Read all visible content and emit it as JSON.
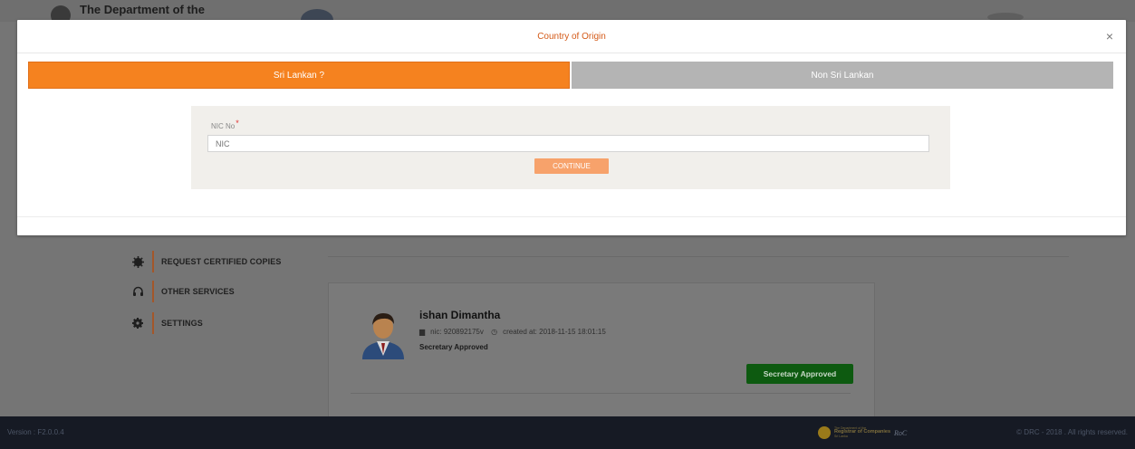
{
  "background": {
    "header": {
      "department_text": "The Department of the"
    },
    "sidebar": {
      "items": [
        {
          "label": "REQUEST CERTIFIED COPIES",
          "icon": "gear-badge-icon"
        },
        {
          "label": "OTHER SERVICES",
          "icon": "headset-icon"
        },
        {
          "label": "SETTINGS",
          "icon": "gear-icon"
        }
      ]
    },
    "card": {
      "name": "ishan Dimantha",
      "nic": "nic: 920892175v",
      "created_at": "created at: 2018-11-15 18:01:15",
      "status_text": "Secretary Approved",
      "status_button": "Secretary Approved"
    },
    "footer": {
      "version": "Version : F2.0.0.4",
      "copyright": "© DRC - 2018 . All rights reserved.",
      "logo_small": "The Department of the",
      "logo_big": "Registrar of Companies",
      "logo_sub": "Sri Lanka",
      "logo_roc": "RoC"
    }
  },
  "modal": {
    "title": "Country of Origin",
    "close_symbol": "×",
    "tabs": [
      {
        "label": "Sri Lankan ?",
        "active": true
      },
      {
        "label": "Non Sri Lankan",
        "active": false
      }
    ],
    "form": {
      "nic_label": "NIC No",
      "required_mark": "*",
      "nic_placeholder": "NIC",
      "continue_label": "CONTINUE"
    }
  },
  "colors": {
    "accent_orange": "#f5821f",
    "title_orange": "#d45a18",
    "approved_green": "#0d5a10"
  }
}
